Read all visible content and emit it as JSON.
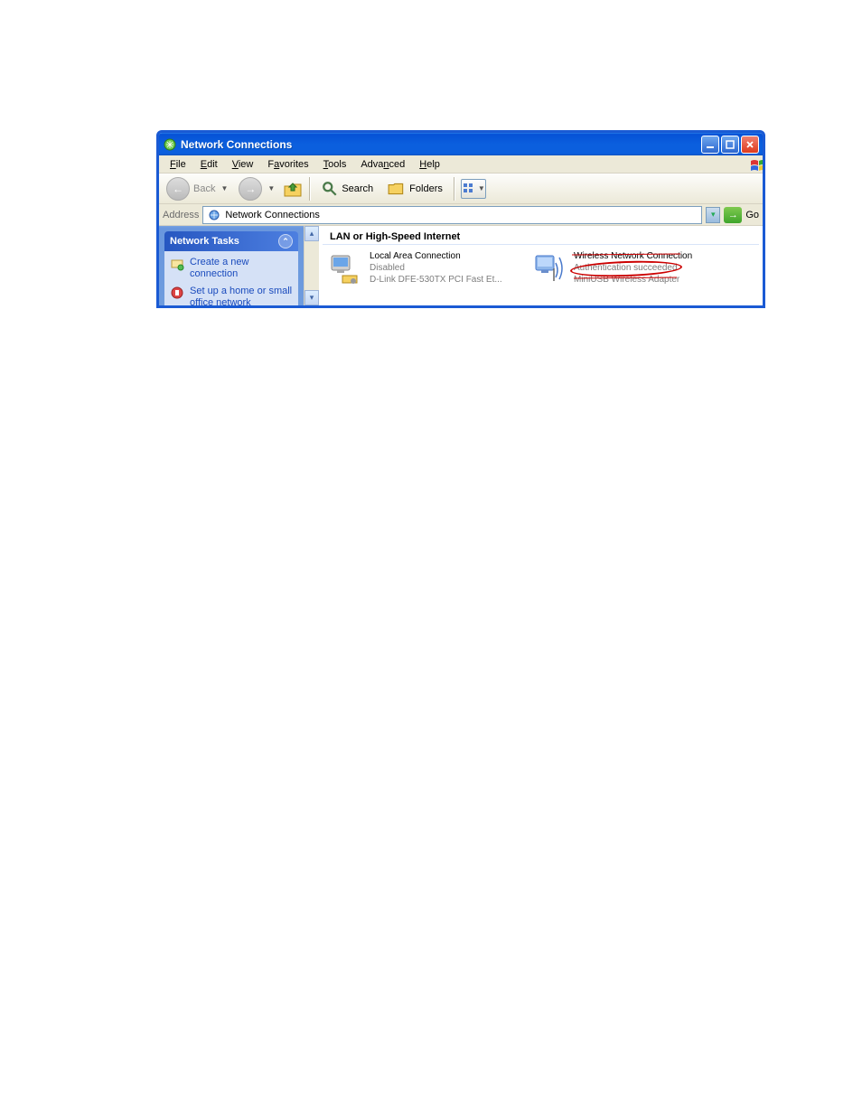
{
  "window": {
    "title": "Network Connections"
  },
  "menu": {
    "file": "File",
    "edit": "Edit",
    "view": "View",
    "favorites": "Favorites",
    "tools": "Tools",
    "advanced": "Advanced",
    "help": "Help"
  },
  "toolbar": {
    "back": "Back",
    "search": "Search",
    "folders": "Folders"
  },
  "address": {
    "label": "Address",
    "value": "Network Connections",
    "go": "Go"
  },
  "sidebar": {
    "tasks_title": "Network Tasks",
    "links": [
      "Create a new connection",
      "Set up a home or small office network"
    ]
  },
  "main": {
    "group_title": "LAN or High-Speed Internet",
    "items": [
      {
        "name": "Local Area Connection",
        "status": "Disabled",
        "device": "D-Link DFE-530TX PCI Fast Et..."
      },
      {
        "name": "Wireless Network Connection",
        "status": "Authentication succeeded",
        "device": "MiniUSB Wireless Adapter"
      }
    ]
  }
}
